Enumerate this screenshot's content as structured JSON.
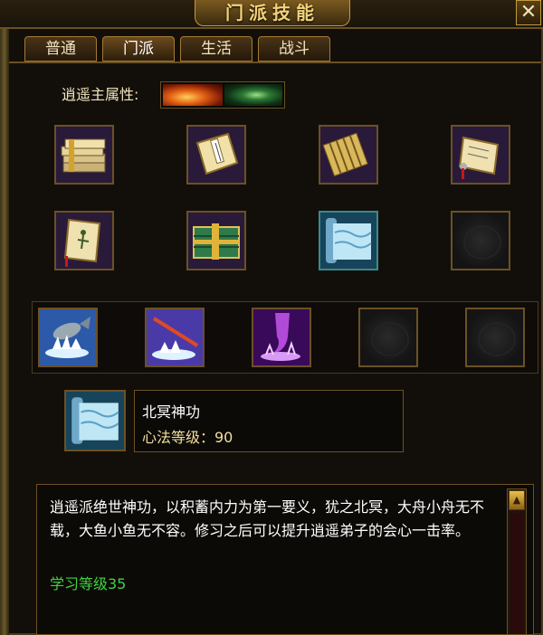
{
  "window": {
    "title": "门派技能",
    "close_glyph": "✕"
  },
  "tabs": [
    {
      "label": "普通",
      "active": false
    },
    {
      "label": "门派",
      "active": true
    },
    {
      "label": "生活",
      "active": false
    },
    {
      "label": "战斗",
      "active": false
    }
  ],
  "attribute": {
    "label": "逍遥主属性:",
    "icons": [
      "fire-attribute-icon",
      "poison-attribute-icon"
    ]
  },
  "skill_grid": [
    {
      "icon": "book-stack-icon",
      "empty": false
    },
    {
      "icon": "manual-book-icon",
      "empty": false
    },
    {
      "icon": "bamboo-scroll-icon",
      "empty": false
    },
    {
      "icon": "open-scroll-icon",
      "empty": false
    },
    {
      "icon": "figure-scroll-icon",
      "empty": false
    },
    {
      "icon": "tied-books-icon",
      "empty": false
    },
    {
      "icon": "blue-scroll-icon",
      "empty": false
    },
    {
      "icon": "empty-slot-icon",
      "empty": true
    }
  ],
  "skill_bar": [
    {
      "icon": "leaping-fish-icon",
      "empty": false
    },
    {
      "icon": "fishing-rod-icon",
      "empty": false
    },
    {
      "icon": "purple-whirlwind-icon",
      "empty": false
    },
    {
      "icon": "empty-slot-icon",
      "empty": true
    },
    {
      "icon": "empty-slot-icon",
      "empty": true
    }
  ],
  "selected_skill": {
    "icon": "blue-scroll-icon",
    "name": "北冥神功",
    "level_text": "心法等级：90"
  },
  "description": {
    "text": "逍遥派绝世神功，以积蓄内力为第一要义，犹之北冥，大舟小舟无不载，大鱼小鱼无不容。修习之后可以提升逍遥弟子的会心一击率。",
    "requirement": "学习等级35"
  },
  "scrollbar": {
    "up_glyph": "▲"
  },
  "colors": {
    "gold_border": "#6b5124",
    "title_gold": "#f3d27a",
    "requirement_green": "#3fd33f"
  }
}
